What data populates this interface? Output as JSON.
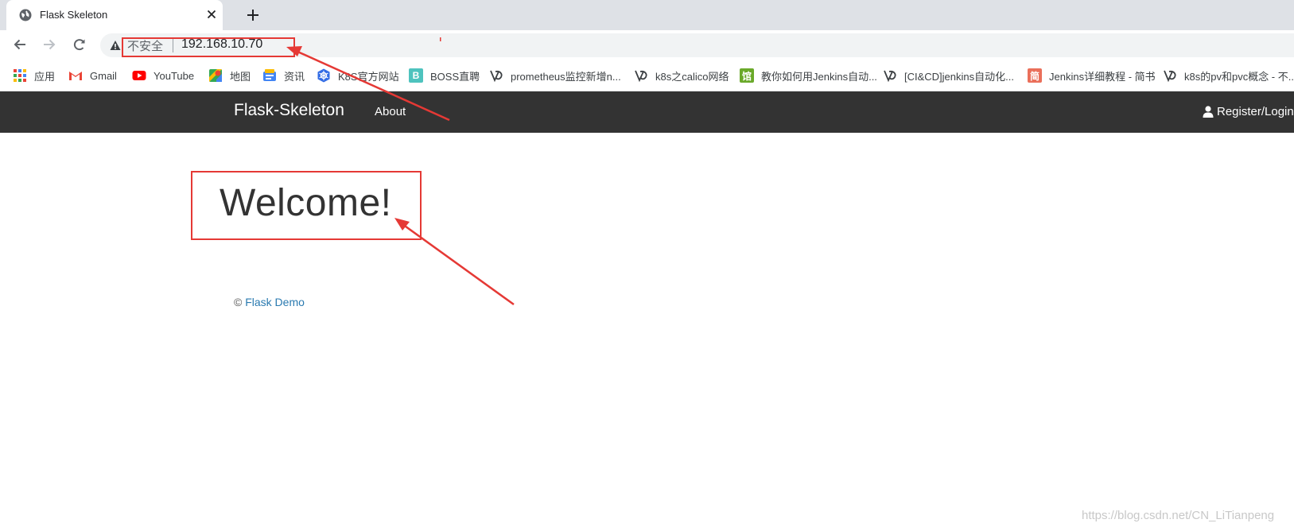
{
  "browser": {
    "tab": {
      "title": "Flask Skeleton",
      "favicon": "globe-icon"
    },
    "address_bar": {
      "security_label": "不安全",
      "url": "192.168.10.70"
    },
    "bookmarks": [
      {
        "label": "应用",
        "icon": "apps-grid-icon"
      },
      {
        "label": "Gmail",
        "icon": "gmail-icon"
      },
      {
        "label": "YouTube",
        "icon": "youtube-icon"
      },
      {
        "label": "地图",
        "icon": "maps-icon"
      },
      {
        "label": "资讯",
        "icon": "news-icon"
      },
      {
        "label": "K8S官方网站",
        "icon": "kubernetes-icon"
      },
      {
        "label": "BOSS直聘",
        "icon": "boss-icon",
        "glyph": "B"
      },
      {
        "label": "prometheus监控新增n...",
        "icon": "csdn-icon"
      },
      {
        "label": "k8s之calico网络",
        "icon": "csdn-icon"
      },
      {
        "label": "教你如何用Jenkins自动...",
        "icon": "page-icon",
        "glyph": "馆"
      },
      {
        "label": "[CI&CD]jenkins自动化...",
        "icon": "csdn-icon"
      },
      {
        "label": "Jenkins详细教程 - 简书",
        "icon": "jianshu-icon",
        "glyph": "简"
      },
      {
        "label": "k8s的pv和pvc概念 - 不...",
        "icon": "csdn-icon"
      }
    ]
  },
  "navbar": {
    "brand": "Flask-Skeleton",
    "about": "About",
    "register": "Register/Login",
    "register_icon": "user-icon"
  },
  "main": {
    "heading": "Welcome!"
  },
  "footer": {
    "copyright": "©",
    "link": "Flask Demo"
  },
  "watermark": "https://blog.csdn.net/CN_LiTianpeng",
  "colors": {
    "navbar_bg": "#333333",
    "link": "#2a7ab0",
    "annotation_red": "#e53935",
    "tab_strip": "#dee1e6",
    "omnibox": "#f1f3f4"
  }
}
